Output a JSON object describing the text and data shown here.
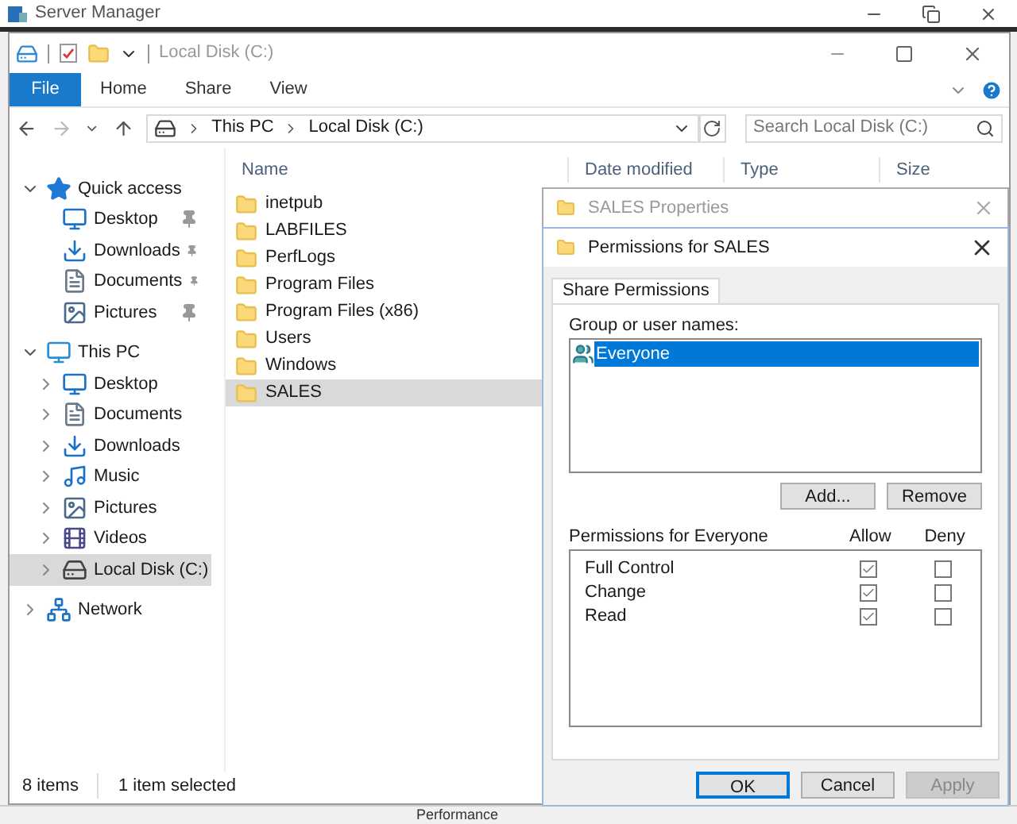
{
  "server_manager": {
    "title": "Server Manager",
    "bottom_text": "Performance"
  },
  "explorer": {
    "title": "Local Disk (C:)",
    "ribbon_tabs": [
      {
        "label": "File",
        "selected": true
      },
      {
        "label": "Home",
        "selected": false
      },
      {
        "label": "Share",
        "selected": false
      },
      {
        "label": "View",
        "selected": false
      }
    ],
    "address_path": [
      "This PC",
      "Local Disk (C:)"
    ],
    "search": {
      "placeholder": "Search Local Disk (C:)"
    },
    "nav": [
      {
        "label": "Quick access",
        "kind": "star",
        "expanded": true,
        "selected": false,
        "children": [
          {
            "label": "Desktop",
            "kind": "desktop",
            "pinned": true,
            "selected": false
          },
          {
            "label": "Downloads",
            "kind": "download",
            "pinned": true,
            "selected": false
          },
          {
            "label": "Documents",
            "kind": "document",
            "pinned": true,
            "selected": false
          },
          {
            "label": "Pictures",
            "kind": "pictures",
            "pinned": true,
            "selected": false
          }
        ]
      },
      {
        "label": "This PC",
        "kind": "pc",
        "expanded": true,
        "selected": false,
        "children": [
          {
            "label": "Desktop",
            "kind": "desktop",
            "pinned": false,
            "expanded": false,
            "selected": false
          },
          {
            "label": "Documents",
            "kind": "document",
            "pinned": false,
            "expanded": false,
            "selected": false
          },
          {
            "label": "Downloads",
            "kind": "download",
            "pinned": false,
            "expanded": false,
            "selected": false
          },
          {
            "label": "Music",
            "kind": "music",
            "pinned": false,
            "expanded": false,
            "selected": false
          },
          {
            "label": "Pictures",
            "kind": "pictures",
            "pinned": false,
            "expanded": false,
            "selected": false
          },
          {
            "label": "Videos",
            "kind": "videos",
            "pinned": false,
            "expanded": false,
            "selected": false
          },
          {
            "label": "Local Disk (C:)",
            "kind": "disk",
            "pinned": false,
            "expanded": false,
            "selected": true
          }
        ]
      },
      {
        "label": "Network",
        "kind": "network",
        "expanded": false,
        "selected": false
      }
    ],
    "columns": [
      "Name",
      "Date modified",
      "Type",
      "Size"
    ],
    "files": [
      {
        "name": "inetpub",
        "selected": false
      },
      {
        "name": "LABFILES",
        "selected": false
      },
      {
        "name": "PerfLogs",
        "selected": false
      },
      {
        "name": "Program Files",
        "selected": false
      },
      {
        "name": "Program Files (x86)",
        "selected": false
      },
      {
        "name": "Users",
        "selected": false
      },
      {
        "name": "Windows",
        "selected": false
      },
      {
        "name": "SALES",
        "selected": true
      }
    ],
    "status": [
      "8 items",
      "1 item selected"
    ]
  },
  "dialog_behind": {
    "title": "SALES Properties"
  },
  "dialog": {
    "title": "Permissions for SALES",
    "tabs": [
      {
        "label": "Share Permissions",
        "selected": true
      }
    ],
    "group_label": "Group or user names:",
    "users": [
      {
        "name": "Everyone",
        "selected": true
      }
    ],
    "buttons": [
      "Add...",
      "Remove"
    ],
    "perm_label": "Permissions for Everyone",
    "perm_columns": [
      "Allow",
      "Deny"
    ],
    "permissions": [
      {
        "name": "Full Control",
        "allow": true,
        "deny": false
      },
      {
        "name": "Change",
        "allow": true,
        "deny": false
      },
      {
        "name": "Read",
        "allow": true,
        "deny": false
      }
    ],
    "footer_buttons": [
      {
        "label": "OK",
        "disabled": false,
        "default": true
      },
      {
        "label": "Cancel",
        "disabled": false,
        "default": false
      },
      {
        "label": "Apply",
        "disabled": true,
        "default": false
      }
    ]
  }
}
